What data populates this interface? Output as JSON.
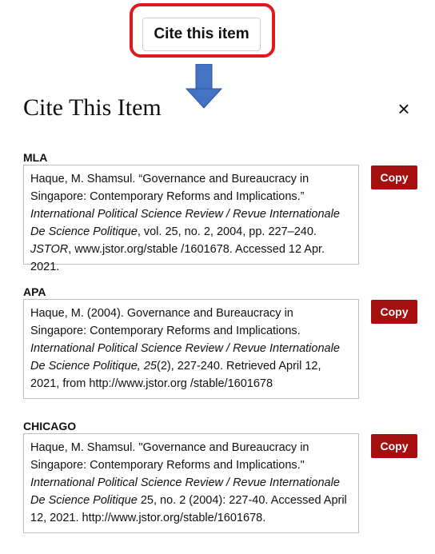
{
  "trigger": {
    "label": "Cite this item"
  },
  "dialog": {
    "title": "Cite This Item",
    "close_label": "×"
  },
  "citations": {
    "mla": {
      "label": "MLA",
      "copy": "Copy",
      "t1": "Haque, M. Shamsul. “Governance and Bureaucracy in Singapore: Contemporary Reforms and Implications.” ",
      "i1": "International Political Science Review / Revue Internationale De Science Politique",
      "t2": ", vol. 25, no. 2, 2004, pp. 227–240. ",
      "i2": "JSTOR",
      "t3": ", www.jstor.org/stable /1601678. Accessed 12 Apr. 2021."
    },
    "apa": {
      "label": "APA",
      "copy": "Copy",
      "t1": "Haque, M. (2004). Governance and Bureaucracy in Singapore: Contemporary Reforms and Implications. ",
      "i1": "International Political Science Review / Revue Internationale De Science Politique, 25",
      "t2": "(2), 227-240. Retrieved April 12, 2021, from http://www.jstor.org /stable/1601678"
    },
    "chicago": {
      "label": "CHICAGO",
      "copy": "Copy",
      "t1": "Haque, M. Shamsul. \"Governance and Bureaucracy in Singapore: Contemporary Reforms and Implications.\" ",
      "i1": "International Political Science Review / Revue Internationale De Science Politique",
      "t2": " 25, no. 2 (2004): 227-40. Accessed April 12, 2021. http://www.jstor.org/stable/1601678."
    }
  },
  "colors": {
    "callout": "#e0191f",
    "arrow": "#4472c4",
    "copy_button": "#a3100f"
  }
}
